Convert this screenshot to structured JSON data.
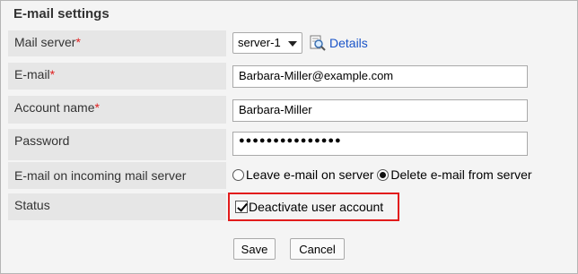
{
  "section": {
    "title": "E-mail settings"
  },
  "fields": {
    "mail_server": {
      "label": "Mail server",
      "required": "*",
      "value": "server-1",
      "details_label": "Details"
    },
    "email": {
      "label": "E-mail",
      "required": "*",
      "value": "Barbara-Miller@example.com"
    },
    "account_name": {
      "label": "Account name",
      "required": "*",
      "value": "Barbara-Miller"
    },
    "password": {
      "label": "Password",
      "value": "●●●●●●●●●●●●●●●"
    },
    "incoming": {
      "label": "E-mail on incoming mail server",
      "options": [
        "Leave e-mail on server",
        "Delete e-mail from server"
      ],
      "selected": "Delete e-mail from server"
    },
    "status": {
      "label": "Status",
      "checkbox_label": "Deactivate user account",
      "checked": true
    }
  },
  "buttons": {
    "save": "Save",
    "cancel": "Cancel"
  },
  "colors": {
    "required_mark": "#e02020",
    "link": "#1a54c8",
    "highlight_border": "#e21b1b"
  },
  "icons": {
    "details": "magnifier-document-icon",
    "status_checkbox": "checkbox-checked-icon"
  }
}
